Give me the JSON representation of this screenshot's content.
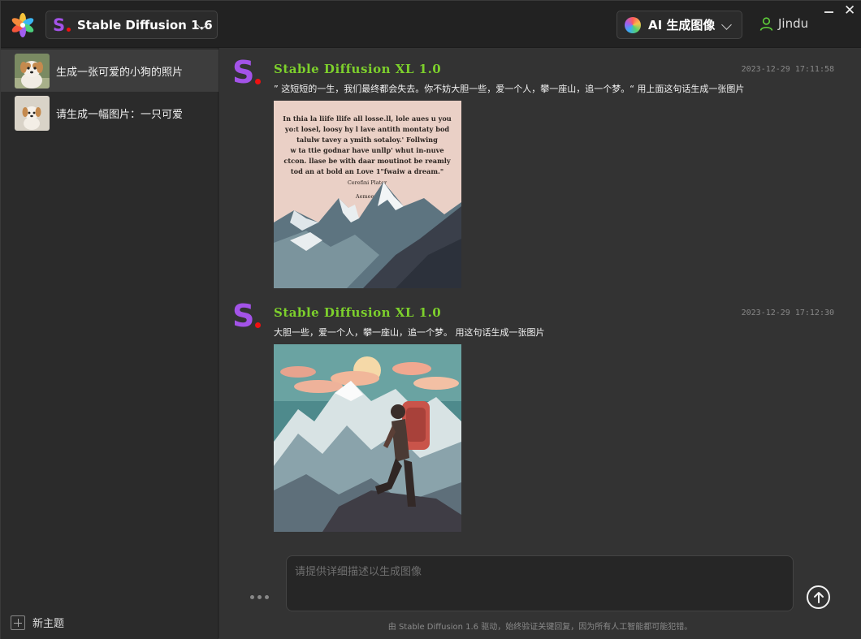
{
  "header": {
    "model_letter": "S",
    "model_name": "Stable Diffusion 1.6",
    "mode_name": "AI 生成图像",
    "user_name": "Jindu",
    "close_glyph": "✕"
  },
  "sidebar": {
    "items": [
      {
        "label": "生成一张可爱的小狗的照片",
        "active": true
      },
      {
        "label": "请生成一幅图片：一只可爱",
        "active": false
      }
    ],
    "new_topic_label": "新主题"
  },
  "messages": [
    {
      "avatar_letter": "S",
      "sender": "Stable Diffusion XL 1.0",
      "time": "2023-12-29 17:11:58",
      "prompt": "” 这短短的一生，我们最终都会失去。你不妨大胆一些，爱一个人，攀一座山，追一个梦。“  用上面这句话生成一张图片",
      "image_text": [
        "In thia la liife llife all losse.ll, lole aues u you",
        "yo:t losel, loosy hy l lave antith montaty bod",
        "talulw tavey a  ymith sotaloy.' Follwing",
        "w ta ttie godnar have unllp' whut in-nuve",
        "ctcon. llase be with daar moutinot be reamly",
        "tod an at bold an Love 1\"fwaiw a dream.\"",
        "Cerefini Plater",
        "Aemeeyl"
      ]
    },
    {
      "avatar_letter": "S",
      "sender": "Stable Diffusion XL 1.0",
      "time": "2023-12-29 17:12:30",
      "prompt": "大胆一些，爱一个人，攀一座山，追一个梦。    用这句话生成一张图片"
    }
  ],
  "composer": {
    "placeholder": "请提供详细描述以生成图像"
  },
  "footer": "由 Stable Diffusion 1.6 驱动，始终验证关键回复，因为所有人工智能都可能犯错。"
}
